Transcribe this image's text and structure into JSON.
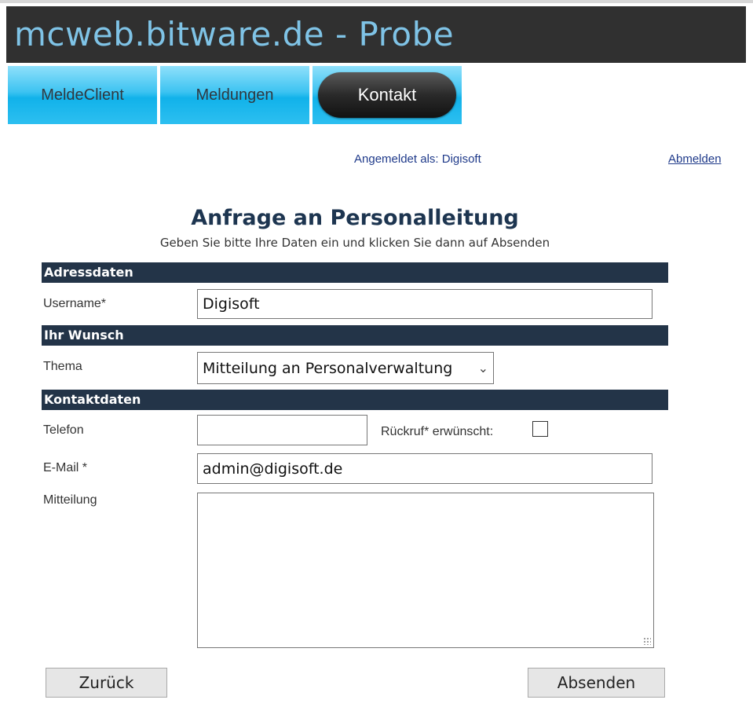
{
  "header": {
    "title": "mcweb.bitware.de - Probe"
  },
  "nav": {
    "tabs": [
      {
        "label": "MeldeClient",
        "active": false
      },
      {
        "label": "Meldungen",
        "active": false
      },
      {
        "label": "Kontakt",
        "active": true
      }
    ]
  },
  "session": {
    "logged_in_text": "Angemeldet als: Digisoft",
    "logout_label": "Abmelden"
  },
  "form": {
    "title": "Anfrage an Personalleitung",
    "subtitle": "Geben Sie bitte Ihre Daten ein und klicken Sie dann auf Absenden",
    "sections": {
      "address": "Adressdaten",
      "wish": "Ihr Wunsch",
      "contact": "Kontaktdaten"
    },
    "username": {
      "label": "Username*",
      "value": "Digisoft"
    },
    "topic": {
      "label": "Thema",
      "value": "Mitteilung an Personalverwaltung"
    },
    "phone": {
      "label": "Telefon",
      "value": ""
    },
    "callback": {
      "label": "Rückruf* erwünscht:",
      "checked": false
    },
    "email": {
      "label": "E-Mail *",
      "value": "admin@digisoft.de"
    },
    "message": {
      "label": "Mitteilung",
      "value": ""
    },
    "buttons": {
      "back": "Zurück",
      "send": "Absenden"
    }
  },
  "colors": {
    "header_bg": "#303030",
    "header_text": "#7fc3e6",
    "tab_blue": "#11b2ea",
    "section_bar": "#233448",
    "link": "#1f3a8a"
  }
}
